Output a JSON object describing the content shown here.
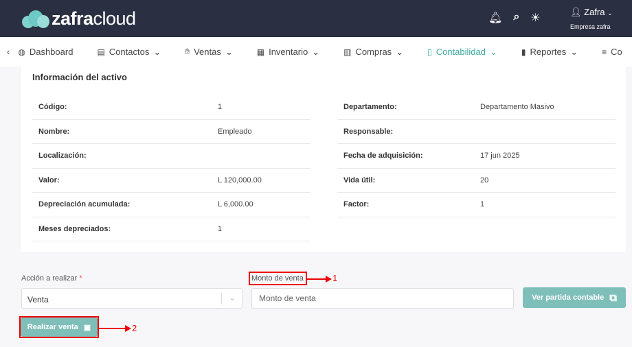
{
  "header": {
    "brand_bold": "zafra",
    "brand_light": "cloud",
    "user_name": "Zafra",
    "company": "Empresa zafra"
  },
  "nav": {
    "items": [
      {
        "label": "Dashboard"
      },
      {
        "label": "Contactos"
      },
      {
        "label": "Ventas"
      },
      {
        "label": "Inventario"
      },
      {
        "label": "Compras"
      },
      {
        "label": "Contabilidad"
      },
      {
        "label": "Reportes"
      },
      {
        "label": "Co"
      }
    ]
  },
  "card": {
    "title": "Información del activo",
    "left": [
      {
        "label": "Código:",
        "value": "1"
      },
      {
        "label": "Nombre:",
        "value": "Empleado"
      },
      {
        "label": "Localización:",
        "value": ""
      },
      {
        "label": "Valor:",
        "value": "L 120,000.00"
      },
      {
        "label": "Depreciación acumulada:",
        "value": "L 6,000.00"
      },
      {
        "label": "Meses depreciados:",
        "value": "1"
      }
    ],
    "right": [
      {
        "label": "Departamento:",
        "value": "Departamento Masivo"
      },
      {
        "label": "Responsable:",
        "value": ""
      },
      {
        "label": "Fecha de adquisición:",
        "value": "17 jun 2025"
      },
      {
        "label": "Vida útil:",
        "value": "20"
      },
      {
        "label": "Factor:",
        "value": "1"
      }
    ]
  },
  "form": {
    "action_label": "Acción a realizar",
    "required_mark": "*",
    "action_value": "Venta",
    "amount_label": "Monto de venta",
    "amount_placeholder": "Monto de venta",
    "amount_value": "",
    "ledger_button": "Ver partida contable",
    "submit_button": "Realizar venta"
  },
  "annotations": {
    "one": "1",
    "two": "2"
  }
}
